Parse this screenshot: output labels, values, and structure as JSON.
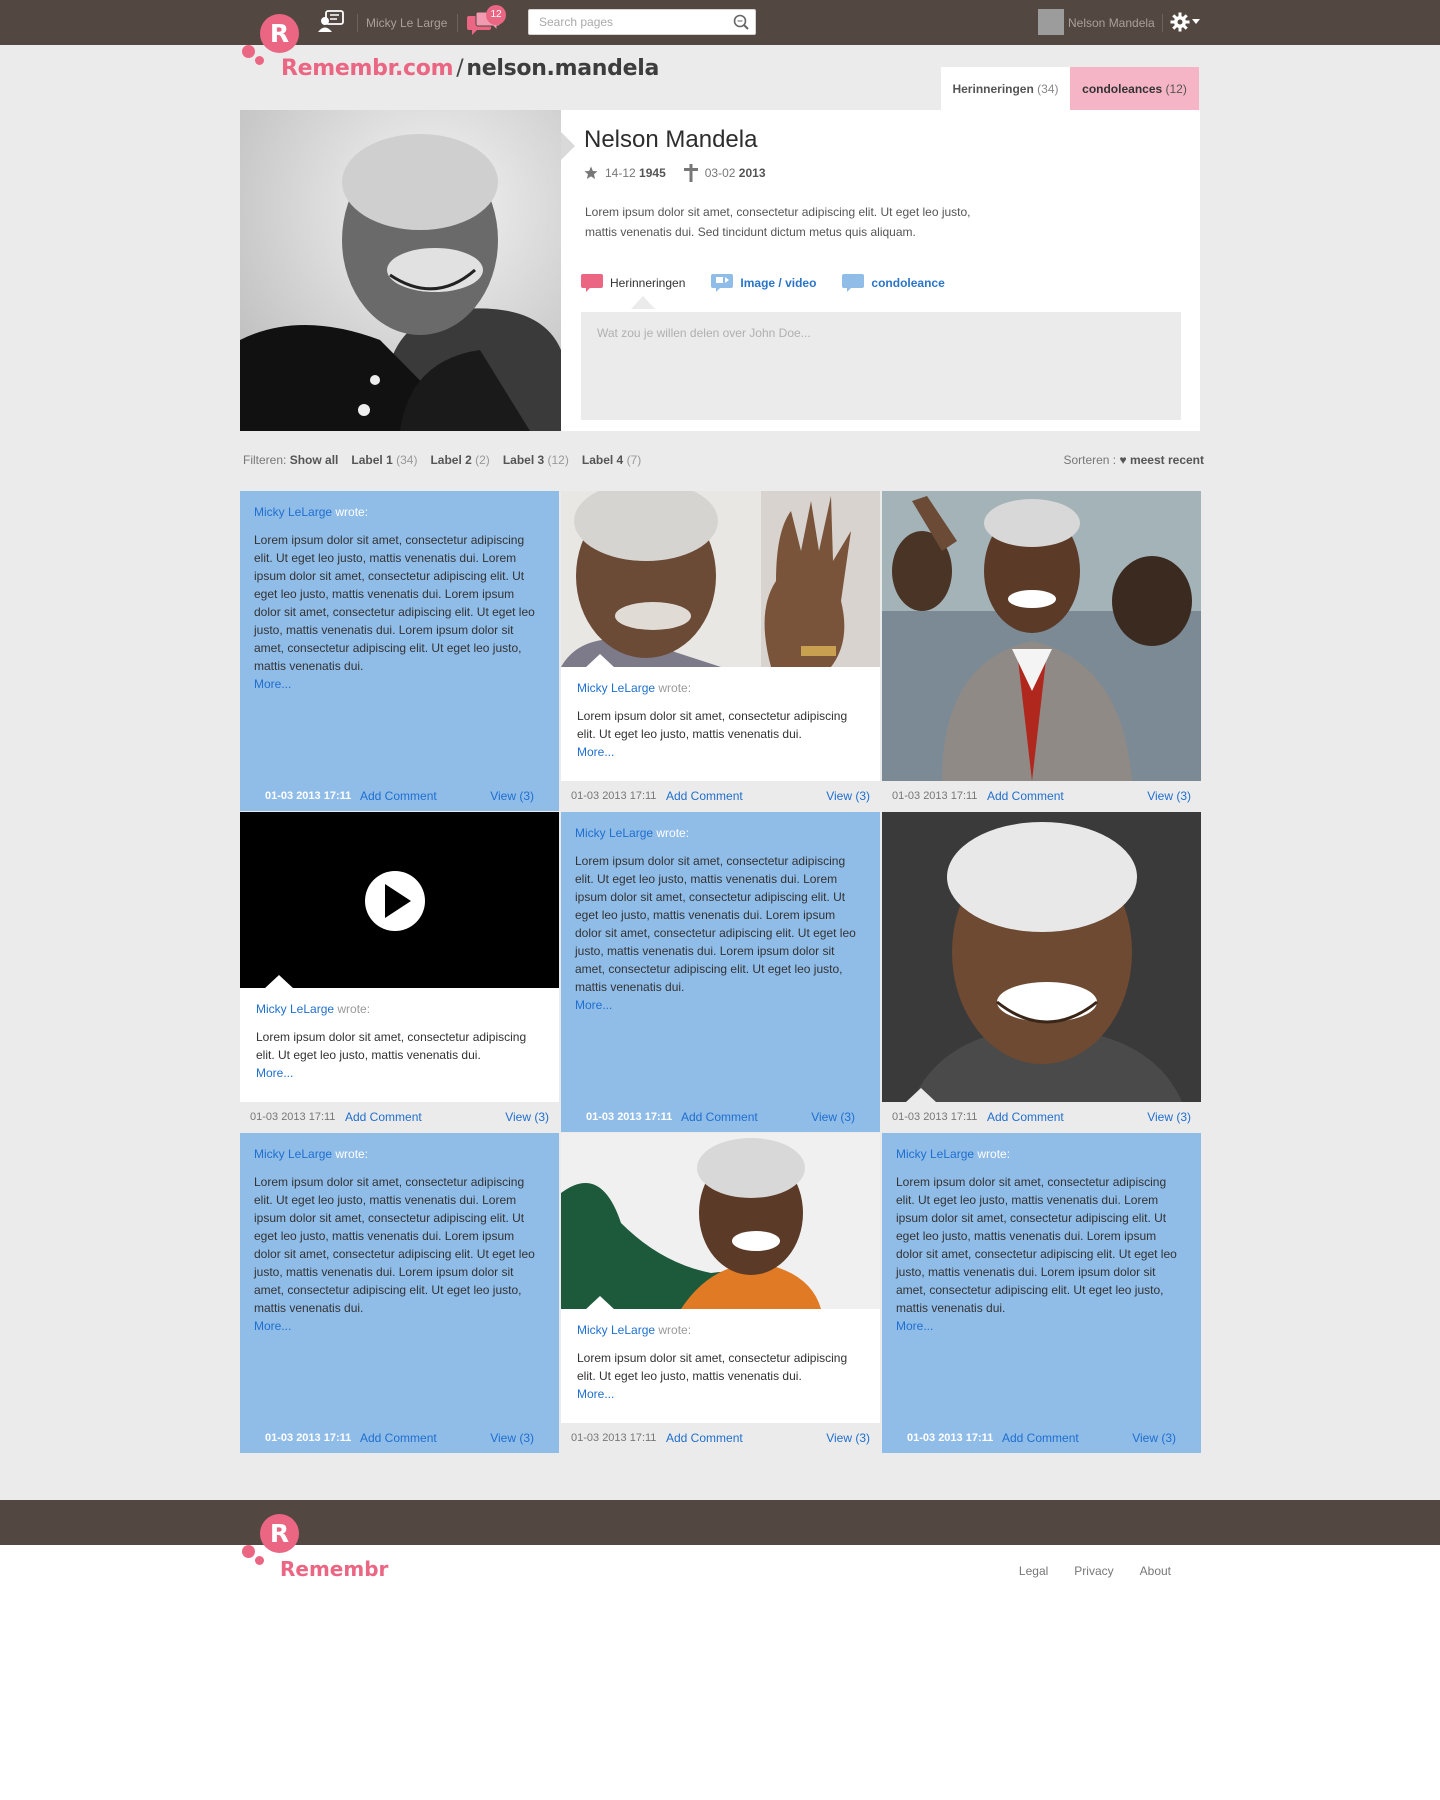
{
  "topbar": {
    "logo_letter": "R",
    "username": "Micky Le Large",
    "message_count": "12",
    "search_placeholder": "Search pages",
    "profile_name": "Nelson Mandela"
  },
  "brand": {
    "site": "Remembr.com",
    "slash": "/",
    "page": "nelson.mandela"
  },
  "tabs": [
    {
      "label": "Herinneringen",
      "count": "(34)"
    },
    {
      "label": "condoleances",
      "count": "(12)"
    }
  ],
  "profile": {
    "name": "Nelson Mandela",
    "born_day": "14-12",
    "born_year": "1945",
    "died_day": "03-02",
    "died_year": "2013",
    "description": "Lorem ipsum dolor sit amet, consectetur adipiscing elit. Ut eget leo justo, mattis venenatis dui. Sed tincidunt dictum metus quis aliquam.",
    "post_types": [
      "Herinneringen",
      "Image / video",
      "condoleance"
    ],
    "compose_placeholder": "Wat zou je willen delen over John Doe..."
  },
  "filters": {
    "prefix": "Filteren:",
    "show_all": "Show all",
    "labels": [
      {
        "name": "Label 1",
        "count": "(34)"
      },
      {
        "name": "Label 2",
        "count": "(2)"
      },
      {
        "name": "Label 3",
        "count": "(12)"
      },
      {
        "name": "Label 4",
        "count": "(7)"
      }
    ],
    "sort_prefix": "Sorteren :",
    "sort_value": "meest recent"
  },
  "post": {
    "author": "Micky LeLarge",
    "wrote": "wrote:",
    "long_text": "Lorem ipsum dolor sit amet, consectetur adipiscing elit. Ut eget leo justo, mattis venenatis dui.  Lorem ipsum dolor sit amet, consectetur adipiscing elit. Ut eget leo justo, mattis venenatis dui. Lorem ipsum dolor sit amet, consectetur adipiscing elit. Ut eget leo justo, mattis venenatis dui. Lorem ipsum dolor sit amet, consectetur adipiscing elit. Ut eget leo justo, mattis venenatis dui.",
    "short_text": "Lorem ipsum dolor sit amet, consectetur adipiscing elit. Ut eget leo justo, mattis venenatis dui.",
    "more": "More...",
    "date": "01-03 2013 17:11",
    "add_comment": "Add Comment",
    "view": "View (3)"
  },
  "footer": {
    "logo_letter": "R",
    "brand": "Remembr",
    "links": [
      "Legal",
      "Privacy",
      "About"
    ]
  },
  "colors": {
    "brand_pink": "#ea6683",
    "topbar_brown": "#534741",
    "card_blue": "#90bce8",
    "link_blue": "#1f6fcf",
    "tab_pink": "#f5b5c6"
  }
}
